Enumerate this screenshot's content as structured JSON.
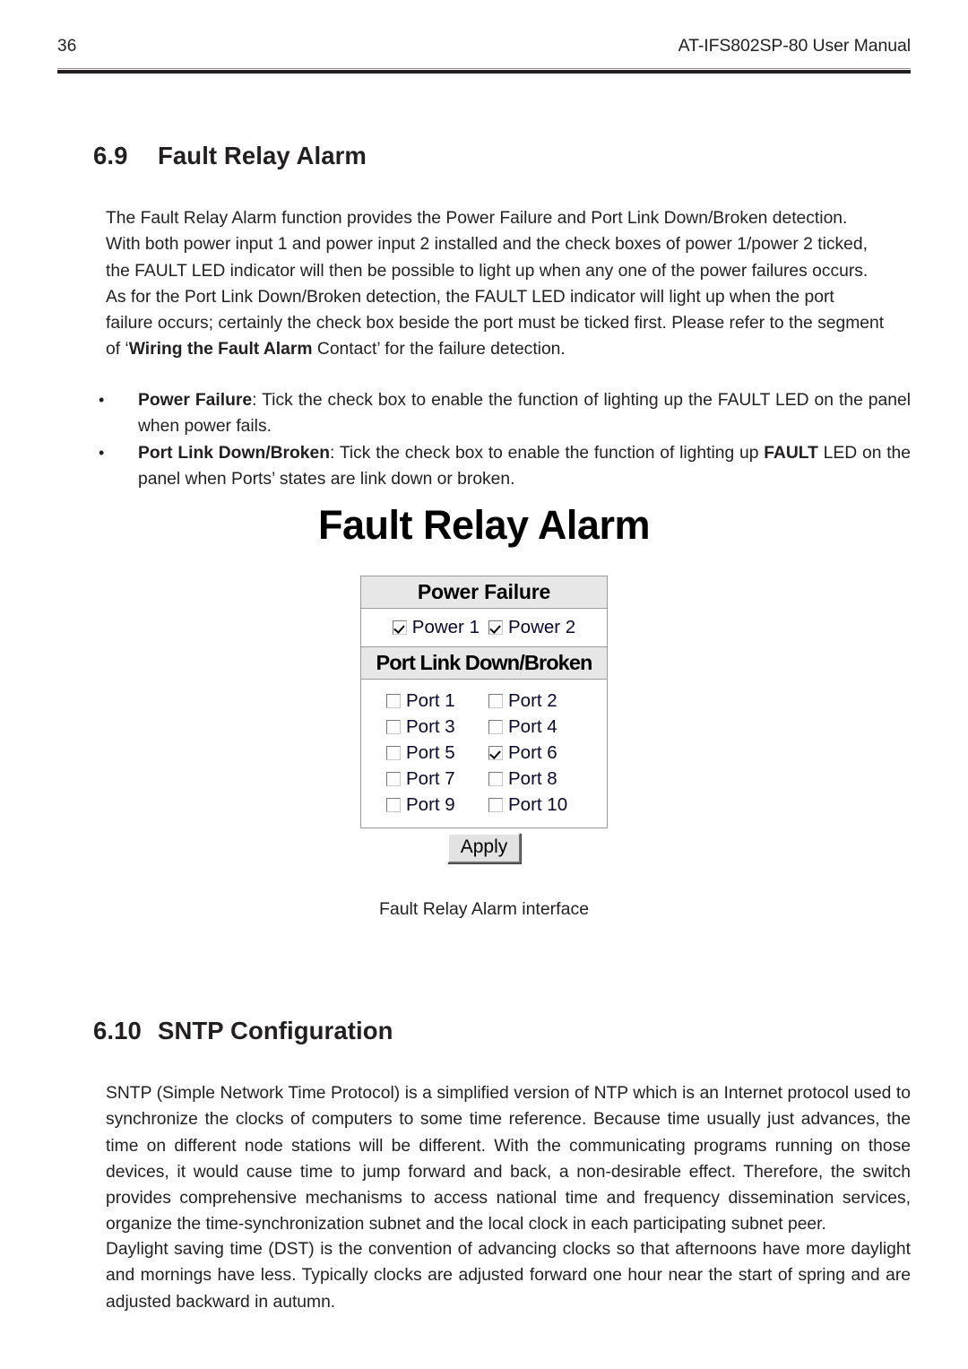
{
  "header": {
    "page_number": "36",
    "manual_title": "AT-IFS802SP-80 User Manual"
  },
  "sections": {
    "fault_relay": {
      "number": "6.9",
      "title": "Fault Relay Alarm",
      "paragraph_lines": [
        "The Fault Relay Alarm function provides the Power Failure and Port Link Down/Broken detection.",
        "With both power input 1 and power input 2 installed and the check boxes of power 1/power 2 ticked,",
        "the FAULT LED indicator will then be possible to light up when any one of the power failures occurs.",
        "As for the Port Link Down/Broken detection, the FAULT LED indicator will light up when the port",
        "failure occurs; certainly the check box beside the port must be ticked first. Please refer to the segment",
        "of ‘"
      ],
      "paragraph_tail_bold": "Wiring the Fault Alarm",
      "paragraph_tail": " Contact’ for the failure detection.",
      "bullets": [
        {
          "marker": "•",
          "lead": "Power Failure",
          "text_before_bold": ": Tick the check box to enable the function of lighting up the FAULT LED on the panel when power fails.",
          "bold_word": "",
          "text_after_bold": ""
        },
        {
          "marker": "•",
          "lead": "Port Link Down/Broken",
          "text_before_bold": ": Tick the check box to enable the function of lighting up ",
          "bold_word": "FAULT",
          "text_after_bold": " LED on the panel when Ports’ states are link down or broken."
        }
      ]
    },
    "sntp": {
      "number": "6.10",
      "title": "SNTP Configuration",
      "paragraph_1": "SNTP (Simple Network Time Protocol) is a simplified version of NTP which is an Internet protocol used to synchronize the clocks of computers to some time reference. Because time usually just advances, the time on different node stations will be different. With the communicating programs running on those devices, it would cause time to jump forward and back, a non-desirable effect. Therefore, the switch provides comprehensive mechanisms to access national time and frequency dissemination services, organize the time-synchronization subnet and the local clock in each participating subnet peer.",
      "paragraph_2": "Daylight saving time (DST) is the convention of advancing clocks so that afternoons have more daylight and mornings have less. Typically clocks are adjusted forward one hour near the start of spring and are adjusted backward in autumn."
    }
  },
  "figure": {
    "title": "Fault Relay Alarm",
    "caption": "Fault Relay Alarm interface",
    "power_failure_header": "Power Failure",
    "power_checkboxes": [
      {
        "label": "Power 1",
        "checked": true
      },
      {
        "label": "Power 2",
        "checked": true
      }
    ],
    "port_link_header": "Port Link Down/Broken",
    "port_rows": [
      [
        {
          "label": "Port 1",
          "checked": false
        },
        {
          "label": "Port 2",
          "checked": false
        }
      ],
      [
        {
          "label": "Port 3",
          "checked": false
        },
        {
          "label": "Port 4",
          "checked": false
        }
      ],
      [
        {
          "label": "Port 5",
          "checked": false
        },
        {
          "label": "Port 6",
          "checked": true
        }
      ],
      [
        {
          "label": "Port 7",
          "checked": false
        },
        {
          "label": "Port 8",
          "checked": false
        }
      ],
      [
        {
          "label": "Port 9",
          "checked": false
        },
        {
          "label": "Port 10",
          "checked": false
        }
      ]
    ],
    "apply_label": "Apply",
    "colors": {
      "header_bg": "#e7e7e7",
      "panel_border": "#9a9a9a",
      "label_text": "#0a0a2a",
      "button_face": "#e2e2e2"
    }
  }
}
